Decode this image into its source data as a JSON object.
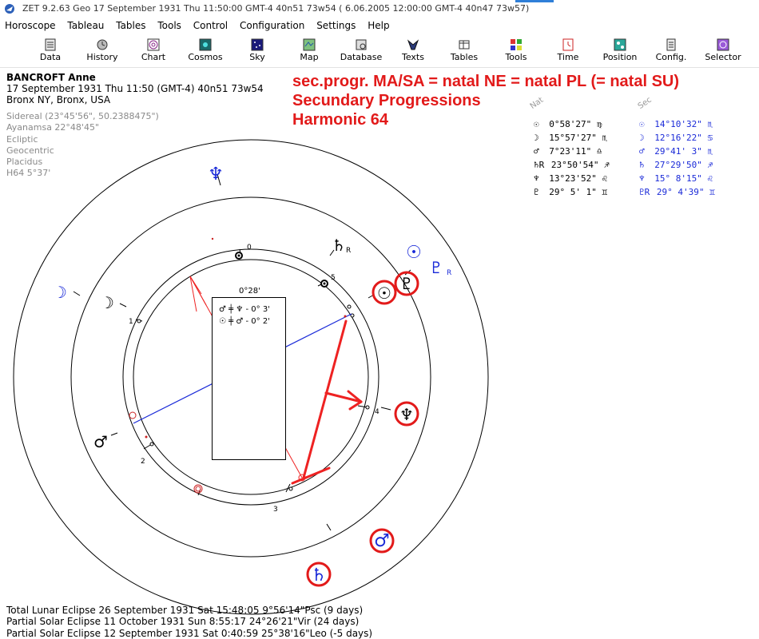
{
  "window": {
    "title": "ZET 9.2.63 Geo    17 September 1931  Thu  11:50:00 GMT-4 40n51  73w54  ( 6.06.2005  12:00:00 GMT-4 40n47 73w57)"
  },
  "menu": [
    "Horoscope",
    "Tableau",
    "Tables",
    "Tools",
    "Control",
    "Configuration",
    "Settings",
    "Help"
  ],
  "toolbar": [
    "Data",
    "History",
    "Chart",
    "Cosmos",
    "Sky",
    "Map",
    "Database",
    "Texts",
    "Tables",
    "Tools",
    "Time",
    "Position",
    "Config.",
    "Selector"
  ],
  "person": {
    "name": "BANCROFT Anne",
    "datetime": "17 September 1931  Thu  11:50 (GMT-4) 40n51  73w54",
    "place": "Bronx NY, Bronx, USA"
  },
  "settings": [
    "Sidereal (23°45'56\", 50.2388475\")",
    "Ayanamsa 22°48'45\"",
    "Ecliptic",
    "Geocentric",
    "Placidus",
    "H64   5°37'"
  ],
  "headline": [
    "sec.progr. MA/SA = natal NE = natal PL (= natal SU)",
    "Secundary Progressions",
    "Harmonic 64"
  ],
  "positions": {
    "nat_header": "Nat",
    "sec_header": "Sec",
    "natal": [
      {
        "glyph": "☉",
        "text": "0°58'27\" ♍"
      },
      {
        "glyph": "☽",
        "text": "15°57'27\" ♏"
      },
      {
        "glyph": "♂",
        "text": "7°23'11\" ♎"
      },
      {
        "glyph": "♄R",
        "text": "23°50'54\" ♐"
      },
      {
        "glyph": "♆",
        "text": "13°23'52\" ♌"
      },
      {
        "glyph": "♇",
        "text": "29° 5' 1\" ♊"
      }
    ],
    "secondary": [
      {
        "glyph": "☉",
        "text": "14°10'32\" ♏"
      },
      {
        "glyph": "☽",
        "text": "12°16'22\" ♋"
      },
      {
        "glyph": "♂",
        "text": "29°41' 3\" ♏"
      },
      {
        "glyph": "♄",
        "text": "27°29'50\" ♐"
      },
      {
        "glyph": "♆",
        "text": "15° 8'15\" ♌"
      },
      {
        "glyph": "♇R",
        "text": "29° 4'39\" ♊"
      }
    ]
  },
  "popup": {
    "orb": "0°28'",
    "lines": [
      "♂ ╪ ♆ - 0° 3'",
      "☉ ╪ ♂ - 0° 2'"
    ]
  },
  "chart_labels": {
    "house_numbers": [
      "0",
      "1",
      "2",
      "3",
      "4",
      "5"
    ],
    "retro_marker": "R"
  },
  "eclipses": [
    "Total Lunar Eclipse 26 September 1931 Sat 15:48:05  9°56'14\"Psc (9 days)",
    "Partial Solar Eclipse 11 October 1931 Sun  8:55:17 24°26'21\"Vir (24 days)",
    "Partial Solar Eclipse 12 September 1931 Sat  0:40:59 25°38'16\"Leo (-5 days)"
  ],
  "colors": {
    "headline": "#e21a1a",
    "secondary": "#1a2ad8",
    "highlight": "#e21a1a",
    "grey_text": "#8a8a8a"
  }
}
